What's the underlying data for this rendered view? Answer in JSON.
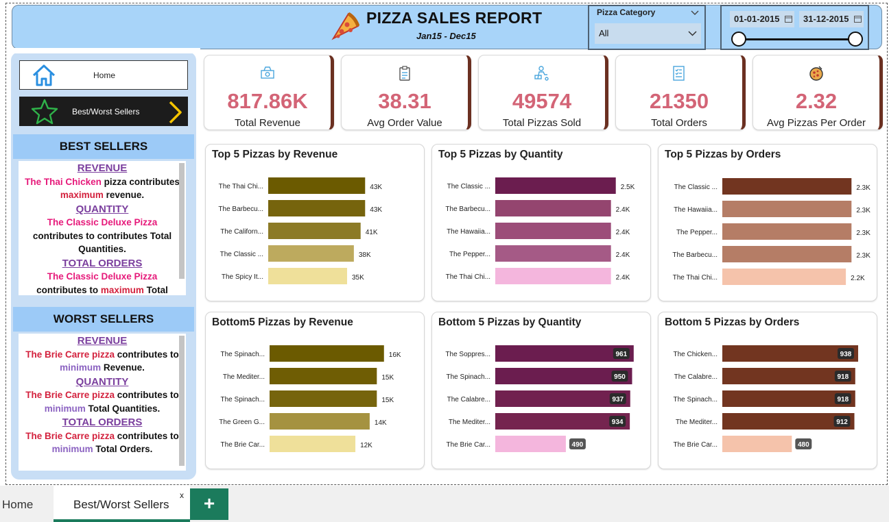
{
  "header": {
    "title": "PIZZA SALES REPORT",
    "subtitle": "Jan15 - Dec15"
  },
  "filters": {
    "category_label": "Pizza Category",
    "category_value": "All",
    "date_start": "01-01-2015",
    "date_end": "31-12-2015"
  },
  "nav": {
    "home_label": "Home",
    "best_worst_label": "Best/Worst Sellers"
  },
  "best": {
    "title": "BEST SELLERS",
    "revenue_head": "REVENUE",
    "revenue_pizza": "The Thai Chicken",
    "revenue_t1": " pizza contributes",
    "revenue_max": "maximum",
    "revenue_t2": " revenue.",
    "quantity_head": "QUANTITY",
    "quantity_pizza": "The Classic Deluxe Pizza",
    "quantity_t1": "contributes to contributes  Total Quantities.",
    "orders_head": "TOTAL ORDERS",
    "orders_pizza": "The Classic Deluxe Pizza",
    "orders_t1": "contributes to ",
    "orders_max": "maximum",
    "orders_t2": "  Total"
  },
  "worst": {
    "title": "WORST SELLERS",
    "revenue_head": "REVENUE",
    "revenue_pizza": "The Brie Carre pizza",
    "revenue_t1": " contributes to",
    "revenue_min": "minimum",
    "revenue_t2": " Revenue.",
    "quantity_head": "QUANTITY",
    "quantity_pizza": "The Brie Carre pizza",
    "quantity_t1": " contributes to",
    "quantity_min": "minimum",
    "quantity_t2": "  Total Quantities.",
    "orders_head": "TOTAL ORDERS",
    "orders_pizza": "The Brie Carre pizza",
    "orders_t1": " contributes to",
    "orders_min": "minimum",
    "orders_t2": "  Total Orders."
  },
  "kpis": [
    {
      "value": "817.86K",
      "label": "Total Revenue",
      "icon": "money-icon"
    },
    {
      "value": "38.31",
      "label": "Avg Order Value",
      "icon": "clipboard-icon"
    },
    {
      "value": "49574",
      "label": "Total Pizzas Sold",
      "icon": "delivery-icon"
    },
    {
      "value": "21350",
      "label": "Total Orders",
      "icon": "checklist-icon"
    },
    {
      "value": "2.32",
      "label": "Avg Pizzas Per Order",
      "icon": "pizza-icon"
    }
  ],
  "tabs": {
    "home": "Home",
    "active": "Best/Worst Sellers",
    "close": "x",
    "add": "+"
  },
  "chart_data": [
    {
      "type": "bar",
      "orientation": "horizontal",
      "title": "Top 5 Pizzas by Revenue",
      "categories": [
        "The Thai Chi...",
        "The Barbecu...",
        "The Californ...",
        "The Classic ...",
        "The Spicy It..."
      ],
      "values": [
        43,
        43,
        41,
        38,
        35
      ],
      "labels": [
        "43K",
        "43K",
        "41K",
        "38K",
        "35K"
      ],
      "colors": [
        "#6b5a00",
        "#76640d",
        "#8c7a26",
        "#bdaa5e",
        "#efe09a"
      ],
      "label_style": "plain",
      "xlim": [
        0,
        70
      ]
    },
    {
      "type": "bar",
      "orientation": "horizontal",
      "title": "Top 5 Pizzas by Quantity",
      "categories": [
        "The Classic ...",
        "The Barbecu...",
        "The Hawaiia...",
        "The Pepper...",
        "The Thai Chi..."
      ],
      "values": [
        2.5,
        2.4,
        2.4,
        2.4,
        2.4
      ],
      "labels": [
        "2.5K",
        "2.4K",
        "2.4K",
        "2.4K",
        "2.4K"
      ],
      "colors": [
        "#6b1d4f",
        "#94456f",
        "#9c4d79",
        "#a55a86",
        "#f4b6dd"
      ],
      "label_style": "plain",
      "xlim": [
        0,
        3.5
      ]
    },
    {
      "type": "bar",
      "orientation": "horizontal",
      "title": "Top 5 Pizzas by Orders",
      "categories": [
        "The Classic ...",
        "The Hawaiia...",
        "The Pepper...",
        "The Barbecu...",
        "The Thai Chi..."
      ],
      "values": [
        2.3,
        2.3,
        2.3,
        2.3,
        2.2
      ],
      "labels": [
        "2.3K",
        "2.3K",
        "2.3K",
        "2.3K",
        "2.2K"
      ],
      "colors": [
        "#723520",
        "#b57d66",
        "#b57d66",
        "#b57d66",
        "#f5c3ab"
      ],
      "label_style": "plain",
      "xlim": [
        0,
        3.2
      ]
    },
    {
      "type": "bar",
      "orientation": "horizontal",
      "title": "Bottom5 Pizzas by Revenue",
      "categories": [
        "The Spinach...",
        "The Mediter...",
        "The Spinach...",
        "The Green G...",
        "The Brie Car..."
      ],
      "values": [
        16,
        15,
        15,
        14,
        12
      ],
      "labels": [
        "16K",
        "15K",
        "15K",
        "14K",
        "12K"
      ],
      "colors": [
        "#6b5a00",
        "#6f5d04",
        "#76640d",
        "#a59240",
        "#efe09a"
      ],
      "label_style": "plain",
      "xlim": [
        0,
        26
      ]
    },
    {
      "type": "bar",
      "orientation": "horizontal",
      "title": "Bottom 5 Pizzas by Quantity",
      "categories": [
        "The Soppres...",
        "The Spinach...",
        "The Calabre...",
        "The Mediter...",
        "The Brie Car..."
      ],
      "values": [
        961,
        950,
        937,
        934,
        490
      ],
      "labels": [
        "961",
        "950",
        "937",
        "934",
        "490"
      ],
      "colors": [
        "#6b1d4f",
        "#6b1d4f",
        "#71214f",
        "#75244f",
        "#f4b6dd"
      ],
      "label_style": "badge",
      "xlim": [
        0,
        1000
      ]
    },
    {
      "type": "bar",
      "orientation": "horizontal",
      "title": "Bottom 5 Pizzas by Orders",
      "categories": [
        "The Chicken...",
        "The Calabre...",
        "The Spinach...",
        "The Mediter...",
        "The Brie Car..."
      ],
      "values": [
        938,
        918,
        918,
        912,
        480
      ],
      "labels": [
        "938",
        "918",
        "918",
        "912",
        "480"
      ],
      "colors": [
        "#723520",
        "#723520",
        "#723520",
        "#723520",
        "#f5c3ab"
      ],
      "label_style": "badge",
      "xlim": [
        0,
        990
      ]
    }
  ]
}
